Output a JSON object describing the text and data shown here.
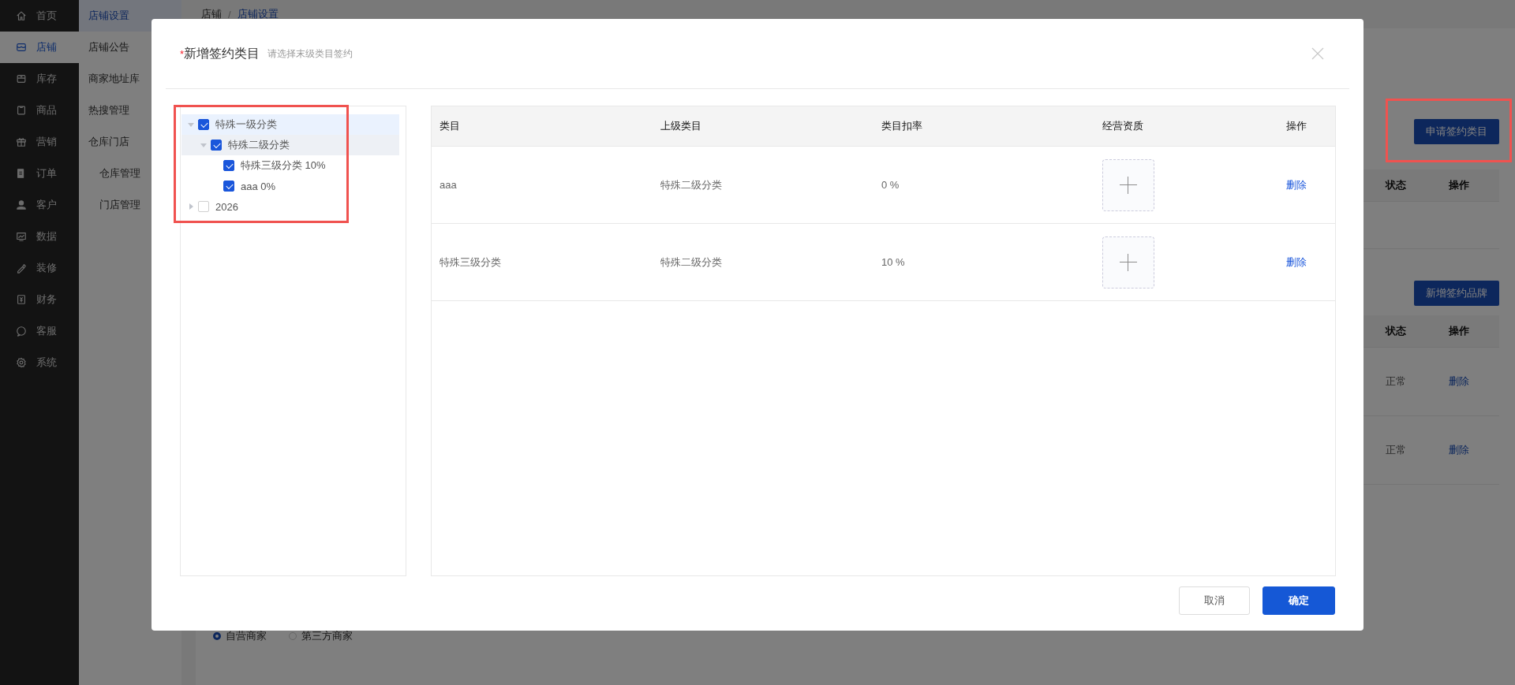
{
  "sidebar": {
    "items": [
      {
        "label": "首页",
        "selected": false
      },
      {
        "label": "店铺",
        "selected": true
      },
      {
        "label": "库存",
        "selected": false
      },
      {
        "label": "商品",
        "selected": false
      },
      {
        "label": "营销",
        "selected": false
      },
      {
        "label": "订单",
        "selected": false
      },
      {
        "label": "客户",
        "selected": false
      },
      {
        "label": "数据",
        "selected": false
      },
      {
        "label": "装修",
        "selected": false
      },
      {
        "label": "财务",
        "selected": false
      },
      {
        "label": "客服",
        "selected": false
      },
      {
        "label": "系统",
        "selected": false
      }
    ]
  },
  "submenu": {
    "items": [
      {
        "label": "店铺设置",
        "selected": true
      },
      {
        "label": "店铺公告",
        "selected": false
      },
      {
        "label": "商家地址库",
        "selected": false
      },
      {
        "label": "热搜管理",
        "selected": false
      },
      {
        "label": "仓库门店",
        "selected": false,
        "children": [
          {
            "label": "仓库管理",
            "selected": false
          },
          {
            "label": "门店管理",
            "selected": false
          }
        ]
      }
    ]
  },
  "breadcrumb": {
    "items": [
      "店铺",
      "店铺设置"
    ],
    "separator": "/"
  },
  "category_section": {
    "button": "申请签约类目",
    "highlighted": true,
    "columns": [
      "状态",
      "操作"
    ]
  },
  "brand_section": {
    "button": "新增签约品牌",
    "columns": [
      "状态",
      "操作"
    ],
    "rows": [
      {
        "status": "正常",
        "action": "删除"
      },
      {
        "status": "正常",
        "action": "删除"
      }
    ]
  },
  "merchant_type": {
    "options": [
      {
        "label": "自营商家",
        "selected": true
      },
      {
        "label": "第三方商家",
        "selected": false
      }
    ]
  },
  "dialog": {
    "required_mark": "*",
    "title": "新增签约类目",
    "hint": "请选择末级类目签约",
    "tree": {
      "highlighted": true,
      "nodes": [
        {
          "label": "特殊一级分类",
          "checked": true,
          "expanded": true,
          "selected": true,
          "hovered": false,
          "children": [
            {
              "label": "特殊二级分类",
              "checked": true,
              "expanded": true,
              "selected": false,
              "hovered": true,
              "children": [
                {
                  "label": "特殊三级分类 10%",
                  "checked": true,
                  "selected": false,
                  "hovered": false
                },
                {
                  "label": "aaa 0%",
                  "checked": true,
                  "selected": false,
                  "hovered": false
                }
              ]
            }
          ]
        },
        {
          "label": "2026",
          "checked": false,
          "expanded": false,
          "selected": false,
          "hovered": false
        }
      ]
    },
    "table": {
      "columns": [
        "类目",
        "上级类目",
        "类目扣率",
        "经营资质",
        "操作"
      ],
      "rows": [
        {
          "category": "aaa",
          "parent": "特殊二级分类",
          "rate": "0 %",
          "action": "删除"
        },
        {
          "category": "特殊三级分类",
          "parent": "特殊二级分类",
          "rate": "10 %",
          "action": "删除"
        }
      ]
    },
    "buttons": [
      {
        "label": "取消",
        "kind": "default"
      },
      {
        "label": "确定",
        "kind": "primary"
      }
    ]
  }
}
